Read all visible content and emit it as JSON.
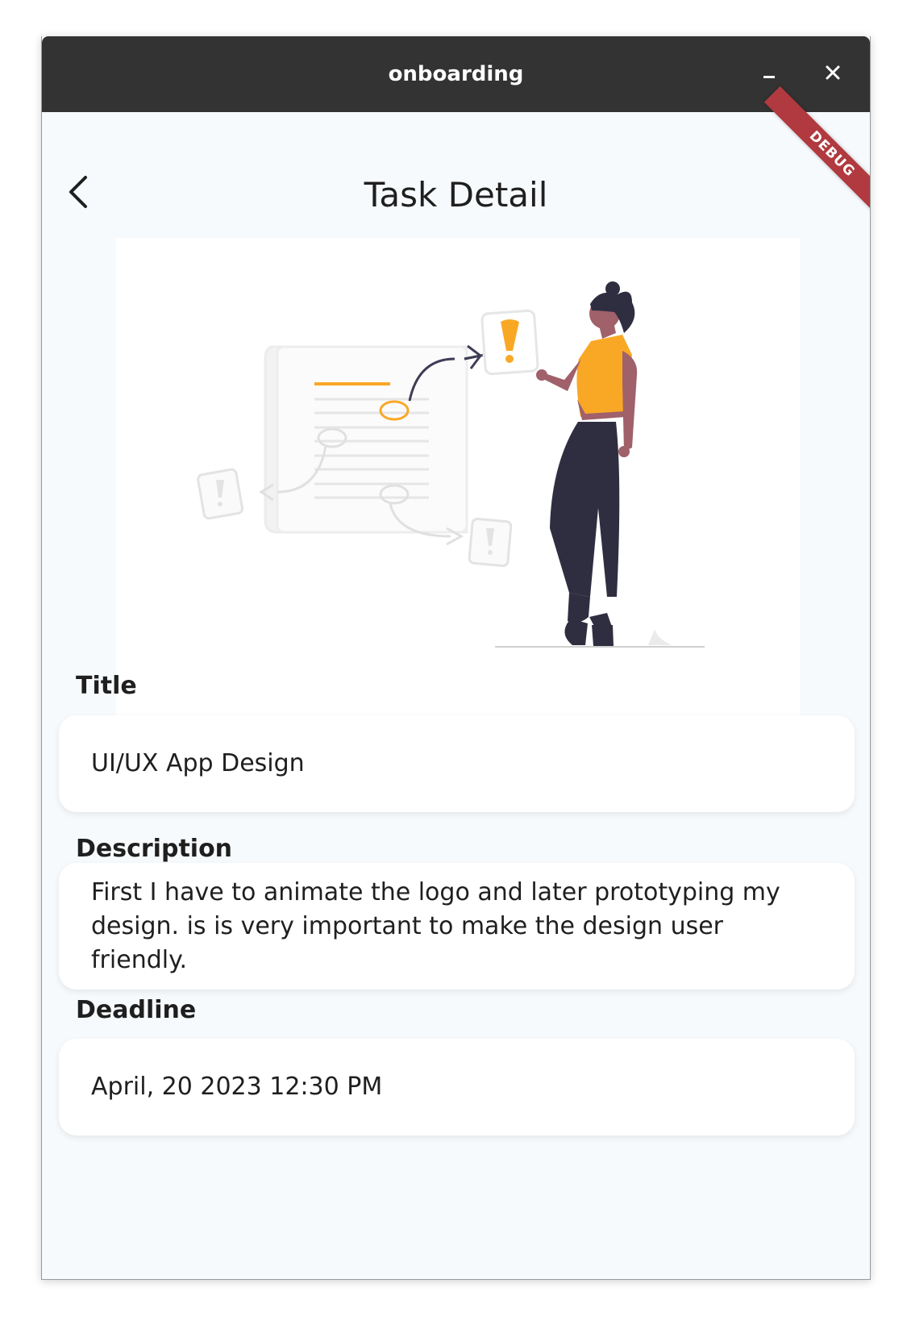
{
  "window": {
    "title": "onboarding",
    "minimize_icon": "minimize-icon",
    "close_icon": "close-icon",
    "debug_banner": "DEBUG"
  },
  "header": {
    "back_icon": "chevron-left-icon",
    "title": "Task Detail"
  },
  "illustration": {
    "name": "task-illustration",
    "accent": "#f9a826",
    "figure_dark": "#2f2e41",
    "skin": "#a0616a"
  },
  "fields": {
    "title_label": "Title",
    "title_value": "UI/UX App Design",
    "description_label": "Description",
    "description_value": "First I have to animate the logo and later prototyping my design. is is very important to make the design user friendly.",
    "deadline_label": "Deadline",
    "deadline_value": "April, 20 2023 12:30 PM"
  },
  "colors": {
    "titlebar": "#333333",
    "background": "#f7fafc",
    "card": "#ffffff",
    "debug_ribbon": "#b03a3f"
  }
}
